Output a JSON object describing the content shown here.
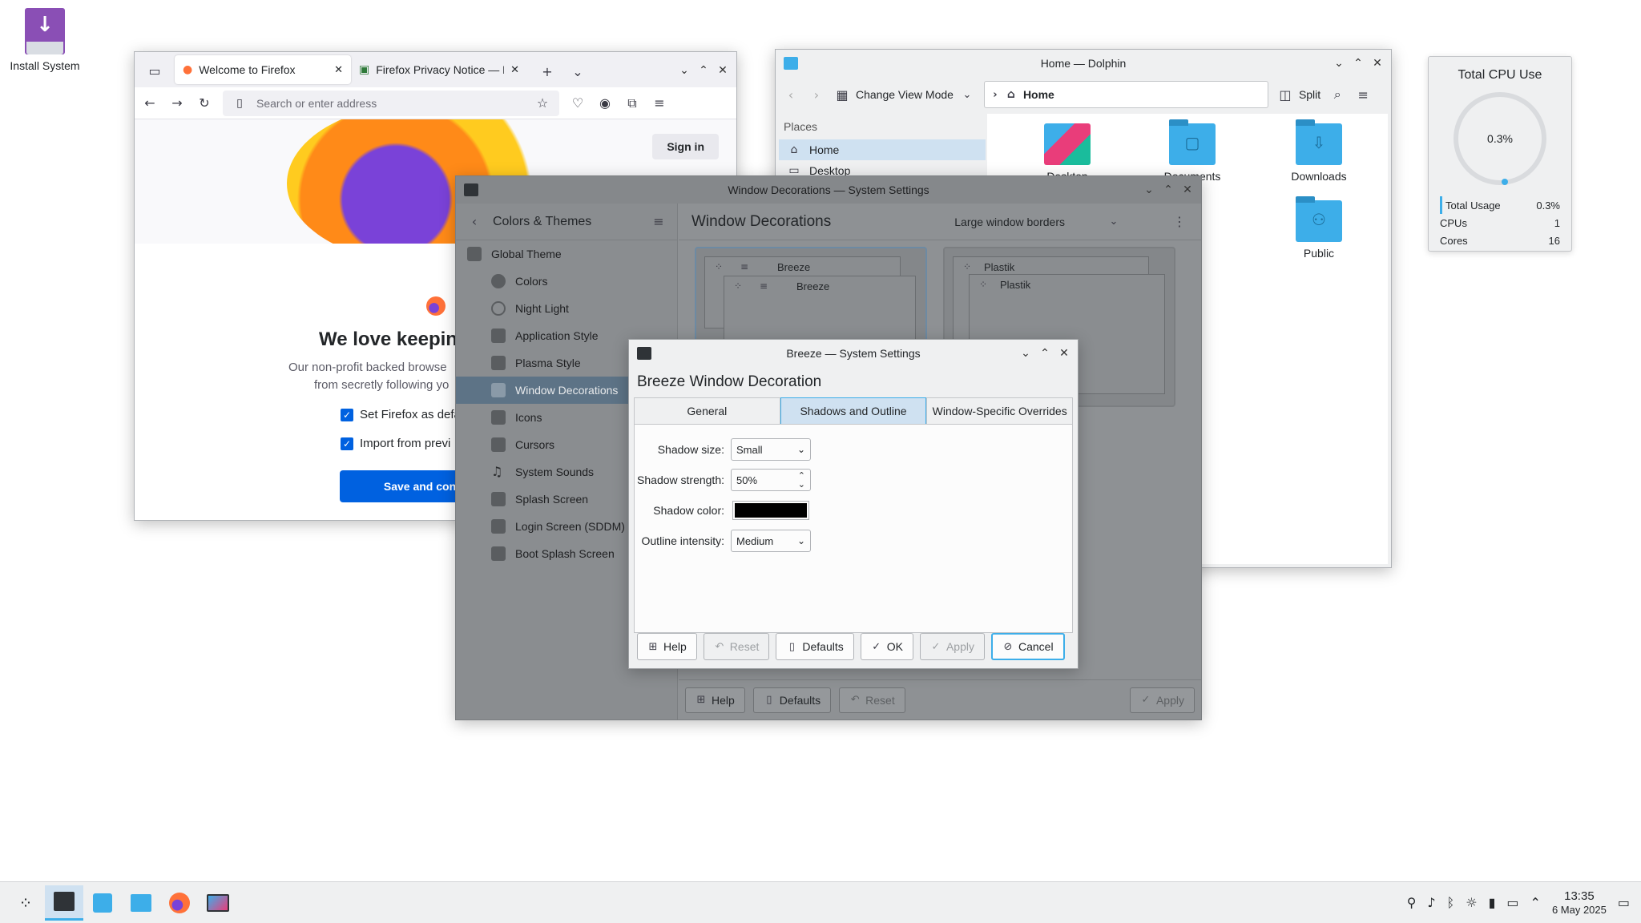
{
  "desktop": {
    "install_label": "Install System"
  },
  "firefox": {
    "tabs": [
      {
        "label": "Welcome to Firefox"
      },
      {
        "label": "Firefox Privacy Notice — M"
      }
    ],
    "url_placeholder": "Search or enter address",
    "sign_in": "Sign in",
    "headline": "We love keepin",
    "body_line1": "Our non-profit backed browse",
    "body_line2": "from secretly following yo",
    "check1": "Set Firefox as defa",
    "check2": "Import from previ",
    "save_button": "Save and con"
  },
  "dolphin": {
    "title": "Home — Dolphin",
    "change_view": "Change View Mode",
    "path": "Home",
    "split": "Split",
    "places_header": "Places",
    "places": [
      {
        "label": "Home"
      },
      {
        "label": "Desktop"
      }
    ],
    "files": [
      {
        "label": "Desktop"
      },
      {
        "label": "Documents"
      },
      {
        "label": "Downloads"
      },
      {
        "label": "Public"
      }
    ]
  },
  "cpu": {
    "title": "Total CPU Use",
    "gauge_value": "0.3%",
    "rows": [
      {
        "label": "Total Usage",
        "value": "0.3%"
      },
      {
        "label": "CPUs",
        "value": "1"
      },
      {
        "label": "Cores",
        "value": "16"
      }
    ]
  },
  "settings": {
    "title": "Window Decorations — System Settings",
    "back_label": "Colors & Themes",
    "page_title": "Window Decorations",
    "border_combo": "Large window borders",
    "top_item": "Global Theme",
    "items": [
      {
        "label": "Colors"
      },
      {
        "label": "Night Light"
      },
      {
        "label": "Application Style"
      },
      {
        "label": "Plasma Style"
      },
      {
        "label": "Window Decorations"
      },
      {
        "label": "Icons"
      },
      {
        "label": "Cursors"
      },
      {
        "label": "System Sounds"
      },
      {
        "label": "Splash Screen"
      },
      {
        "label": "Login Screen (SDDM)"
      },
      {
        "label": "Boot Splash Screen"
      }
    ],
    "preview1_label": "Breeze",
    "preview2_label": "Plastik",
    "footer": {
      "help": "Help",
      "defaults": "Defaults",
      "reset": "Reset",
      "apply": "Apply"
    }
  },
  "breeze": {
    "title": "Breeze — System Settings",
    "heading": "Breeze Window Decoration",
    "tabs": [
      {
        "label": "General"
      },
      {
        "label": "Shadows and Outline"
      },
      {
        "label": "Window-Specific Overrides"
      }
    ],
    "shadow_size_label": "Shadow size:",
    "shadow_size_value": "Small",
    "shadow_strength_label": "Shadow strength:",
    "shadow_strength_value": "50%",
    "shadow_color_label": "Shadow color:",
    "shadow_color_value": "#000000",
    "outline_label": "Outline intensity:",
    "outline_value": "Medium",
    "buttons": {
      "help": "Help",
      "reset": "Reset",
      "defaults": "Defaults",
      "ok": "OK",
      "apply": "Apply",
      "cancel": "Cancel"
    }
  },
  "taskbar": {
    "time": "13:35",
    "date": "6 May 2025"
  },
  "colors": {
    "accent": "#3daee9",
    "selection": "#cfe1f1",
    "firefox_primary": "#0061e0"
  }
}
